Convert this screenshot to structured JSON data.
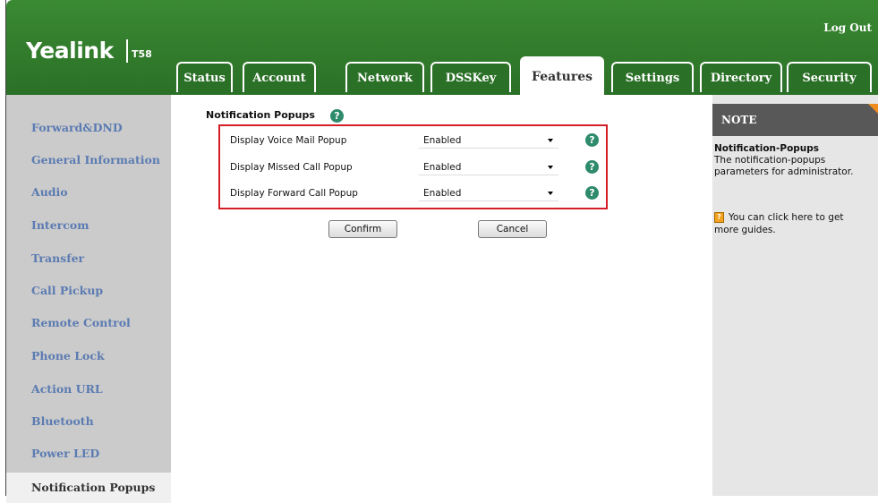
{
  "header": {
    "brand": "Yealink",
    "model": "T58",
    "logout_label": "Log Out",
    "accent_color": "#2b7027"
  },
  "tabs": [
    {
      "label": "Status"
    },
    {
      "label": "Account"
    },
    {
      "label": "Network"
    },
    {
      "label": "DSSKey"
    },
    {
      "label": "Features",
      "active": true
    },
    {
      "label": "Settings"
    },
    {
      "label": "Directory"
    },
    {
      "label": "Security"
    }
  ],
  "sidebar": {
    "items": [
      {
        "label": "Forward&DND"
      },
      {
        "label": "General Information"
      },
      {
        "label": "Audio"
      },
      {
        "label": "Intercom"
      },
      {
        "label": "Transfer"
      },
      {
        "label": "Call Pickup"
      },
      {
        "label": "Remote Control"
      },
      {
        "label": "Phone Lock"
      },
      {
        "label": "Action URL"
      },
      {
        "label": "Bluetooth"
      },
      {
        "label": "Power LED"
      },
      {
        "label": "Notification Popups",
        "active": true
      }
    ]
  },
  "main": {
    "section_title": "Notification Popups",
    "rows": [
      {
        "label": "Display Voice Mail Popup",
        "value": "Enabled"
      },
      {
        "label": "Display Missed Call Popup",
        "value": "Enabled"
      },
      {
        "label": "Display Forward Call Popup",
        "value": "Enabled"
      }
    ],
    "confirm_label": "Confirm",
    "cancel_label": "Cancel",
    "help_glyph": "?"
  },
  "note": {
    "heading": "NOTE",
    "title": "Notification-Popups",
    "text_line1": "The notification-popups",
    "text_line2": "parameters for administrator.",
    "guide_line1": "You can click here to get",
    "guide_line2": "more guides.",
    "guide_icon_glyph": "?"
  }
}
